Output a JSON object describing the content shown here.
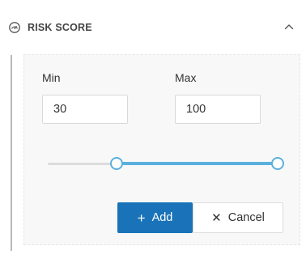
{
  "section": {
    "title": "RISK SCORE",
    "header_icon": "gauge-icon",
    "toggle_icon": "chevron-up-icon"
  },
  "filter": {
    "min_label": "Min",
    "max_label": "Max",
    "min_value": "30",
    "max_value": "100",
    "range": {
      "min": 0,
      "max": 100,
      "low": 30,
      "high": 100
    }
  },
  "actions": {
    "add_label": "Add",
    "add_icon": "plus-icon",
    "cancel_label": "Cancel",
    "cancel_icon": "x-icon"
  },
  "colors": {
    "accent": "#5ab0de",
    "primary_button": "#1a73b8"
  }
}
